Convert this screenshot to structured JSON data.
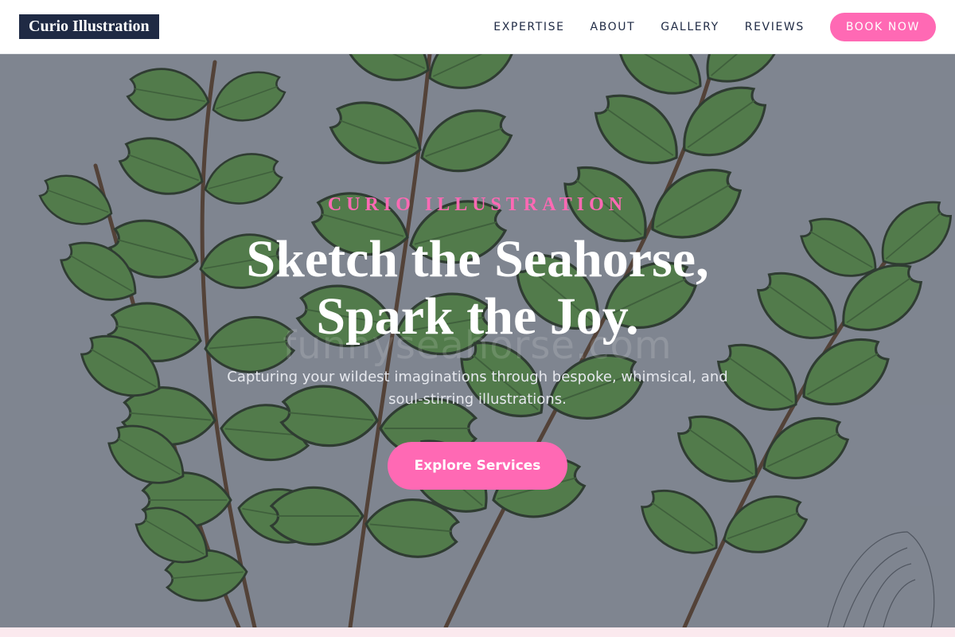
{
  "header": {
    "logo": "Curio Illustration",
    "nav": [
      "EXPERTISE",
      "ABOUT",
      "GALLERY",
      "REVIEWS"
    ],
    "cta": "BOOK NOW"
  },
  "hero": {
    "eyebrow": "CURIO ILLUSTRATION",
    "headline_line1": "Sketch the Seahorse,",
    "headline_line2": "Spark the Joy.",
    "subtext": "Capturing your wildest imaginations through bespoke, whimsical, and soul-stirring illustrations.",
    "cta": "Explore Services",
    "watermark": "funnyseahorse.com"
  },
  "colors": {
    "accent": "#ff69b4",
    "logo_bg": "#1f2a44",
    "leaf": "#4f8a3a",
    "stem": "#5a3b24"
  }
}
